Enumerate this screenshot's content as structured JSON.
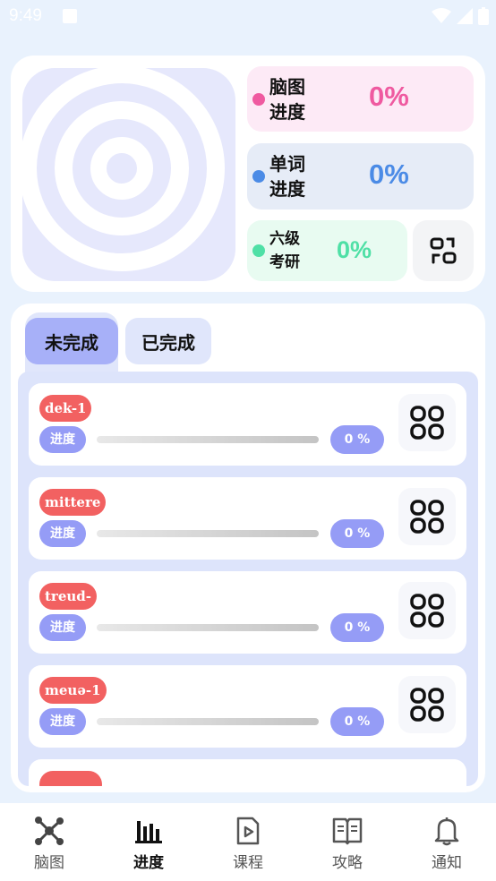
{
  "status": {
    "time": "9:49"
  },
  "stats": {
    "mind": {
      "label": "脑图\n进度",
      "line1": "脑图",
      "line2": "进度",
      "value": "0%",
      "color": "#ef5aa0"
    },
    "word": {
      "line1": "单词",
      "line2": "进度",
      "value": "0%",
      "color": "#4b8be6"
    },
    "cet": {
      "line1": "六级",
      "line2": "考研",
      "value": "0%",
      "color": "#4fe0a6"
    }
  },
  "tabs": {
    "incomplete": "未完成",
    "complete": "已完成"
  },
  "items": [
    {
      "word": "dek-1",
      "progress_label": "进度",
      "progress": 0,
      "percent": "0 %"
    },
    {
      "word": "mittere",
      "progress_label": "进度",
      "progress": 0,
      "percent": "0 %"
    },
    {
      "word": "treud-",
      "progress_label": "进度",
      "progress": 0,
      "percent": "0 %"
    },
    {
      "word": "meuə-1",
      "progress_label": "进度",
      "progress": 0,
      "percent": "0 %"
    }
  ],
  "nav": [
    {
      "label": "脑图",
      "icon": "mindmap-icon"
    },
    {
      "label": "进度",
      "icon": "bar-chart-icon",
      "active": true
    },
    {
      "label": "课程",
      "icon": "course-video-icon"
    },
    {
      "label": "攻略",
      "icon": "book-icon"
    },
    {
      "label": "通知",
      "icon": "bell-icon"
    }
  ]
}
